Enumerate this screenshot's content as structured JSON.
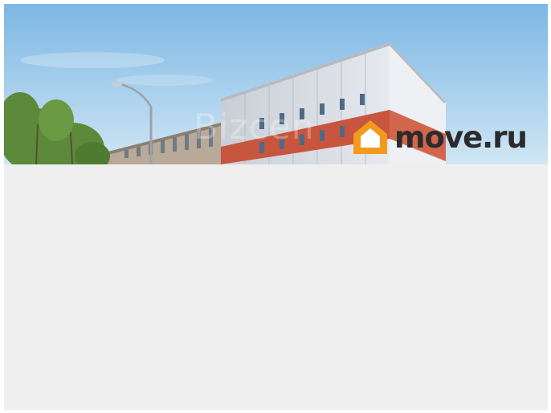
{
  "photo": {
    "description_icon": "building-photo",
    "colors": {
      "sky_top": "#7fb8e3",
      "sky_bottom": "#c4e0f2",
      "facade": "#d9dde3",
      "stripe": "#c8553d",
      "trees": "#5f8f3c"
    }
  },
  "watermark": {
    "text": "Bizcen"
  },
  "brand": {
    "logo_icon": "house-logo-icon",
    "text": "move.ru",
    "accent_color": "#f39a1e"
  }
}
